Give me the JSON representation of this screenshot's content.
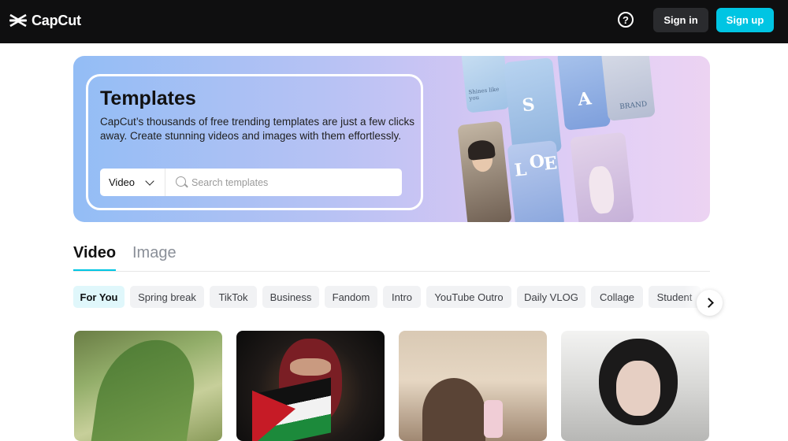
{
  "header": {
    "logo_text": "CapCut",
    "help_icon": "question-circle-icon",
    "signin_label": "Sign in",
    "signup_label": "Sign up",
    "brand_color": "#00c5e3"
  },
  "hero": {
    "title": "Templates",
    "description": "CapCut’s thousands of free trending templates are just a few clicks away. Create stunning videos and images with them effortlessly.",
    "search": {
      "type_selected": "Video",
      "placeholder": "Search templates"
    },
    "collage_captions": [
      "Shines like you",
      "S",
      "A",
      "L",
      "O",
      "E",
      "BRAND"
    ]
  },
  "tabs": [
    {
      "label": "Video",
      "active": true
    },
    {
      "label": "Image",
      "active": false
    }
  ],
  "chips": [
    {
      "label": "For You",
      "active": true
    },
    {
      "label": "Spring break"
    },
    {
      "label": "TikTok"
    },
    {
      "label": "Business"
    },
    {
      "label": "Fandom"
    },
    {
      "label": "Intro"
    },
    {
      "label": "YouTube Outro"
    },
    {
      "label": "Daily VLOG"
    },
    {
      "label": "Collage"
    },
    {
      "label": "Student"
    }
  ]
}
